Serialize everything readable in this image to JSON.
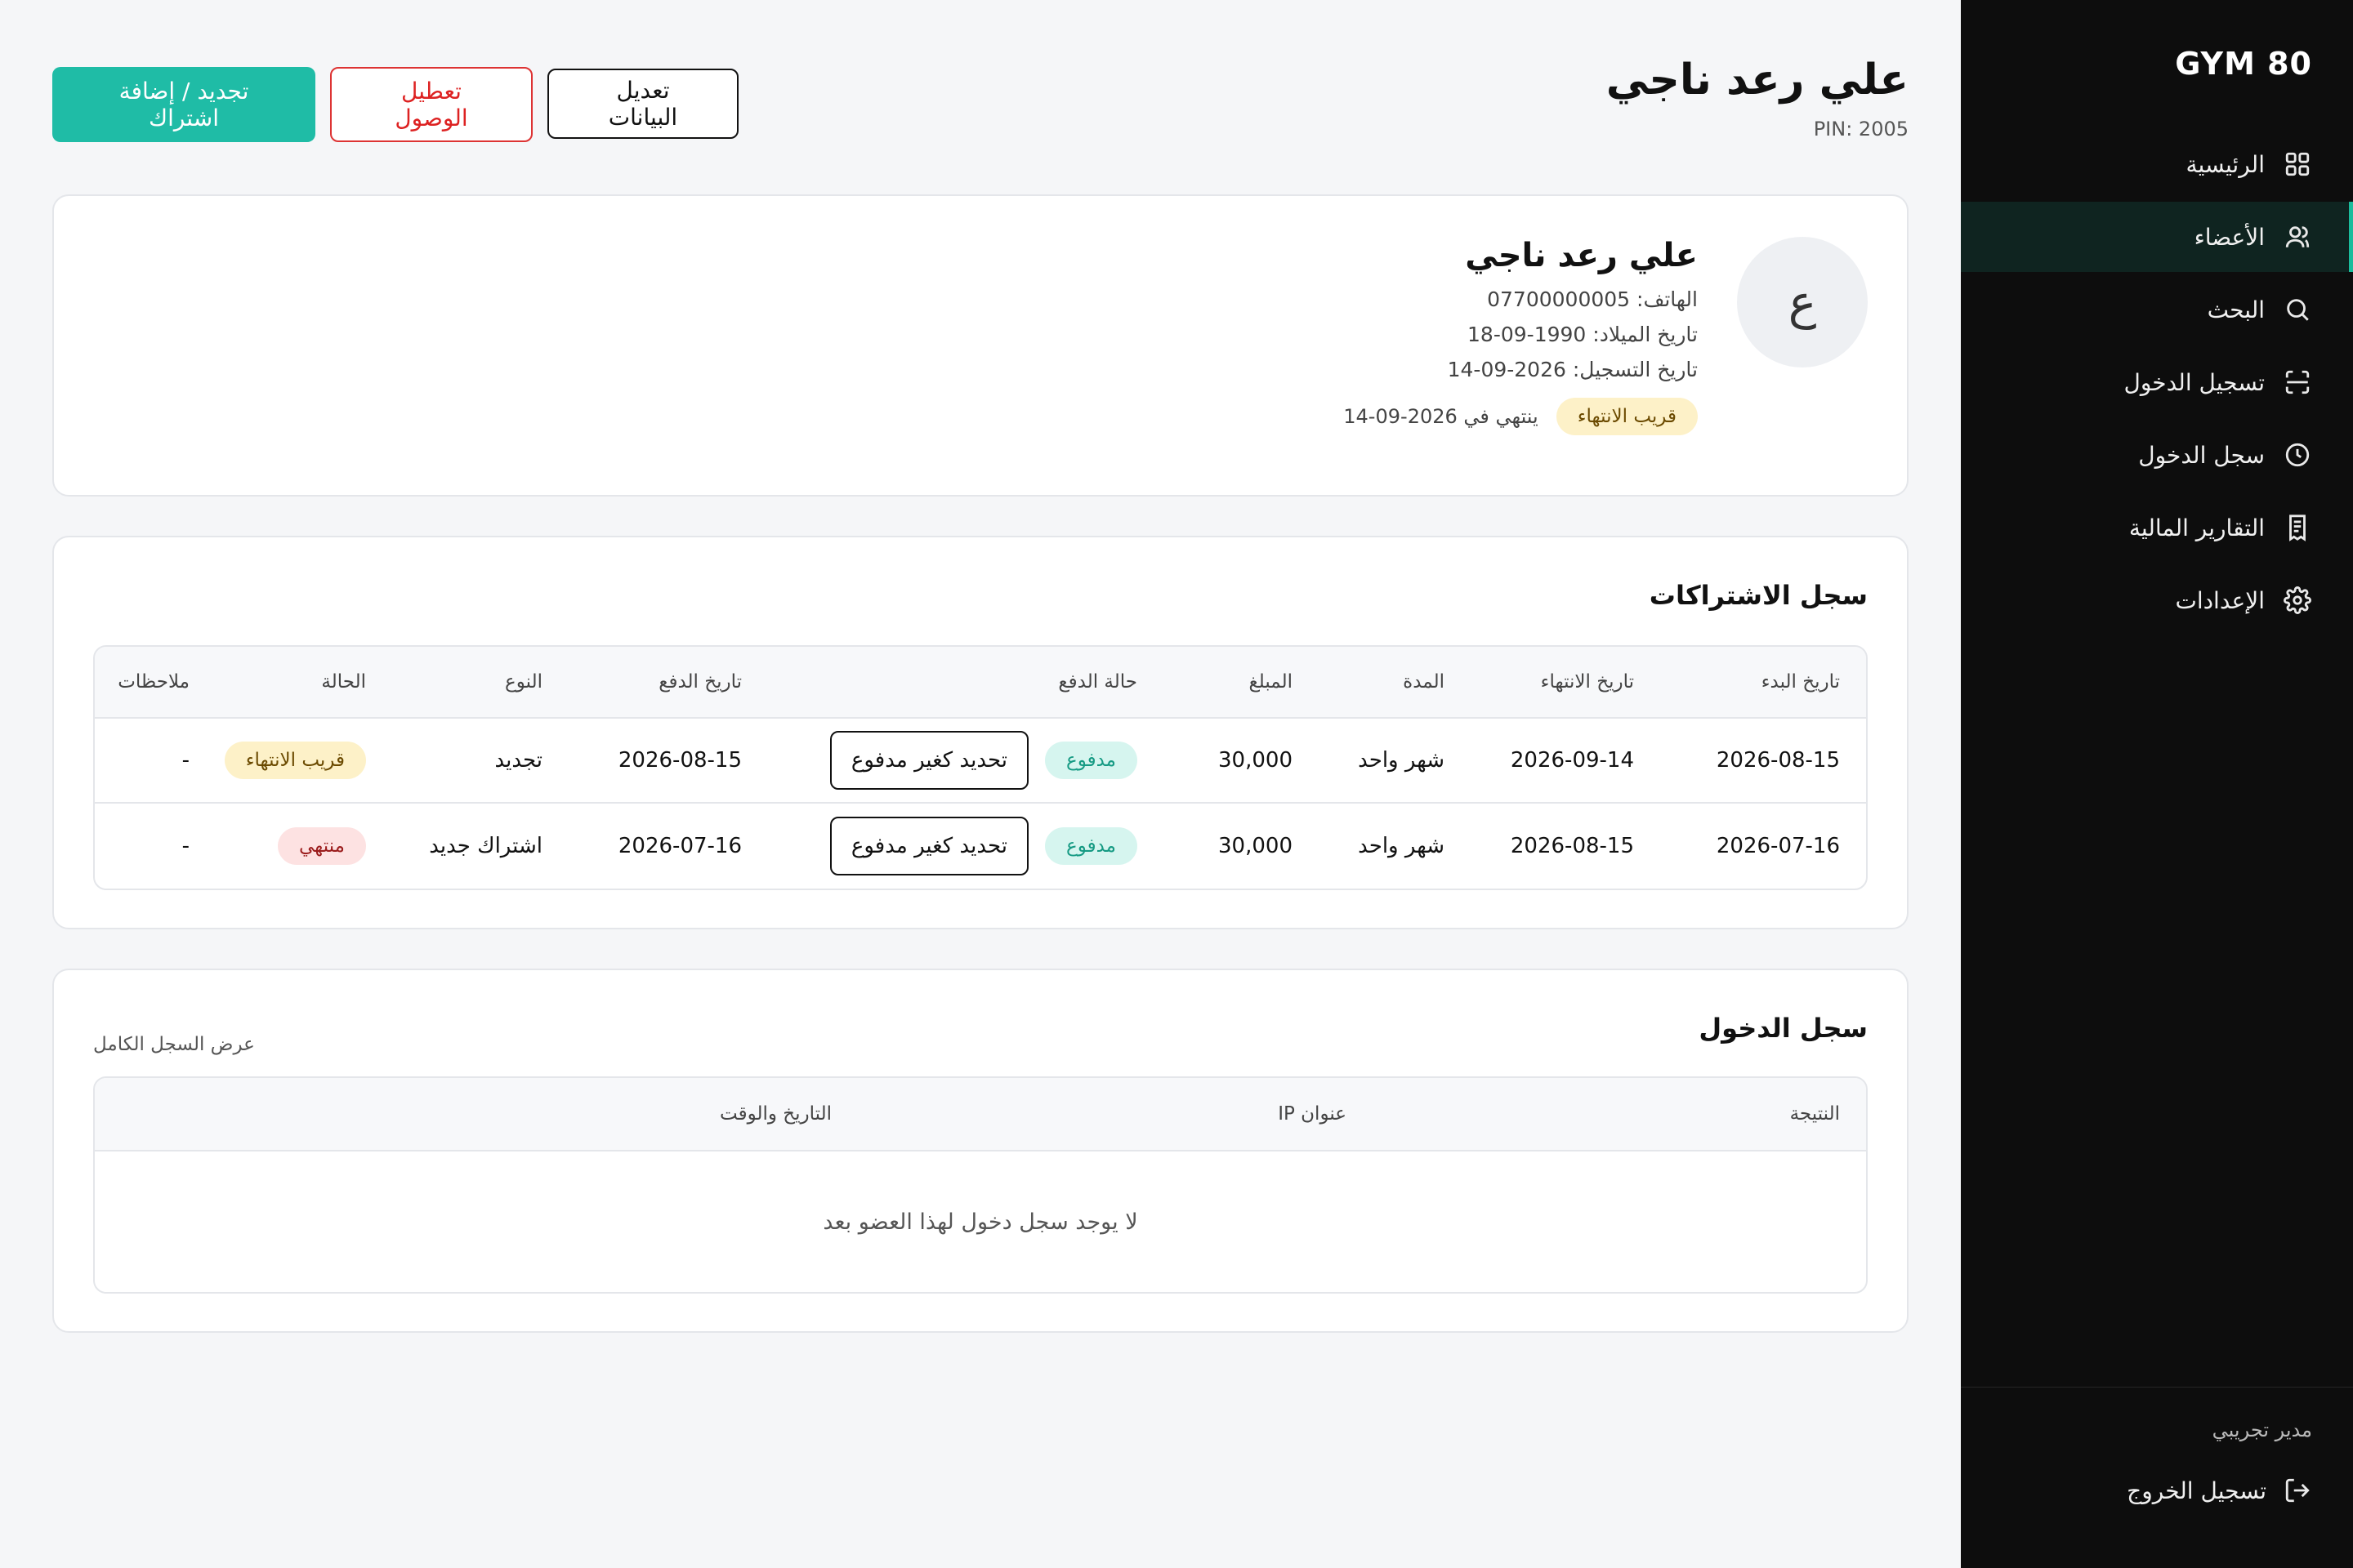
{
  "sidebar": {
    "brand": "GYM 80",
    "items": [
      {
        "label": "الرئيسية",
        "icon": "grid-icon",
        "active": false
      },
      {
        "label": "الأعضاء",
        "icon": "users-icon",
        "active": true
      },
      {
        "label": "البحث",
        "icon": "search-icon",
        "active": false
      },
      {
        "label": "تسجيل الدخول",
        "icon": "scan-icon",
        "active": false
      },
      {
        "label": "سجل الدخول",
        "icon": "clock-icon",
        "active": false
      },
      {
        "label": "التقارير المالية",
        "icon": "receipt-icon",
        "active": false
      },
      {
        "label": "الإعدادات",
        "icon": "gear-icon",
        "active": false
      }
    ],
    "admin_name": "مدير تجريبي",
    "logout_label": "تسجيل الخروج"
  },
  "header": {
    "title": "علي رعد ناجي",
    "pin": "PIN: 2005",
    "actions": {
      "renew": "تجديد / إضافة اشتراك",
      "disable": "تعطيل الوصول",
      "edit": "تعديل البيانات"
    }
  },
  "profile": {
    "avatar_letter": "ع",
    "name": "علي رعد ناجي",
    "phone": "الهاتف: 07700000005",
    "birth": "تاريخ الميلاد: 1990-09-18",
    "registered": "تاريخ التسجيل: 2026-09-14",
    "status_badge": "قريب الانتهاء",
    "expiry": "ينتهي في 2026-09-14"
  },
  "subscriptions": {
    "title": "سجل الاشتراكات",
    "headers": {
      "start": "تاريخ البدء",
      "end": "تاريخ الانتهاء",
      "duration": "المدة",
      "amount": "المبلغ",
      "payment_status": "حالة الدفع",
      "payment_date": "تاريخ الدفع",
      "type": "النوع",
      "status": "الحالة",
      "notes": "ملاحظات"
    },
    "rows": [
      {
        "start": "2026-08-15",
        "end": "2026-09-14",
        "duration": "شهر واحد",
        "amount": "30,000",
        "payment_badge": "مدفوع",
        "action": "تحديد كغير مدفوع",
        "payment_date": "2026-08-15",
        "type": "تجديد",
        "status": "قريب الانتهاء",
        "status_kind": "warn",
        "notes": "-"
      },
      {
        "start": "2026-07-16",
        "end": "2026-08-15",
        "duration": "شهر واحد",
        "amount": "30,000",
        "payment_badge": "مدفوع",
        "action": "تحديد كغير مدفوع",
        "payment_date": "2026-07-16",
        "type": "اشتراك جديد",
        "status": "منتهي",
        "status_kind": "danger",
        "notes": "-"
      }
    ]
  },
  "access_log": {
    "title": "سجل الدخول",
    "view_all": "عرض السجل الكامل",
    "headers": {
      "result": "النتيجة",
      "ip": "عنوان IP",
      "datetime": "التاريخ والوقت"
    },
    "empty": "لا يوجد سجل دخول لهذا العضو بعد"
  }
}
